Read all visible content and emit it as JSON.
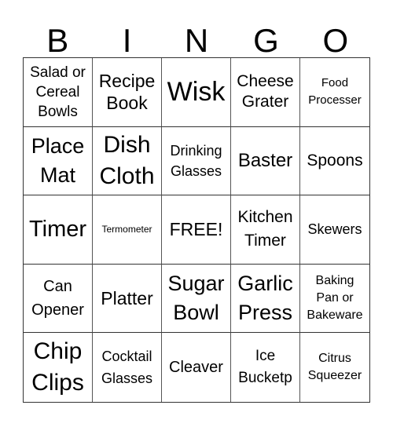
{
  "header": [
    "B",
    "I",
    "N",
    "G",
    "O"
  ],
  "cells": [
    "Salad or\nCereal\nBowls",
    "Recipe\nBook",
    "Wisk",
    "Cheese\nGrater",
    "Food\nProcesser",
    "Place\nMat",
    "Dish\nCloth",
    "Drinking\nGlasses",
    "Baster",
    "Spoons",
    "Timer",
    "Termometer",
    "FREE!",
    "Kitchen\nTimer",
    "Skewers",
    "Can\nOpener",
    "Platter",
    "Sugar\nBowl",
    "Garlic\nPress",
    "Baking\nPan or\nBakeware",
    "Chip\nClips",
    "Cocktail\nGlasses",
    "Cleaver",
    "Ice\nBucketp",
    "Citrus\nSqueezer"
  ]
}
